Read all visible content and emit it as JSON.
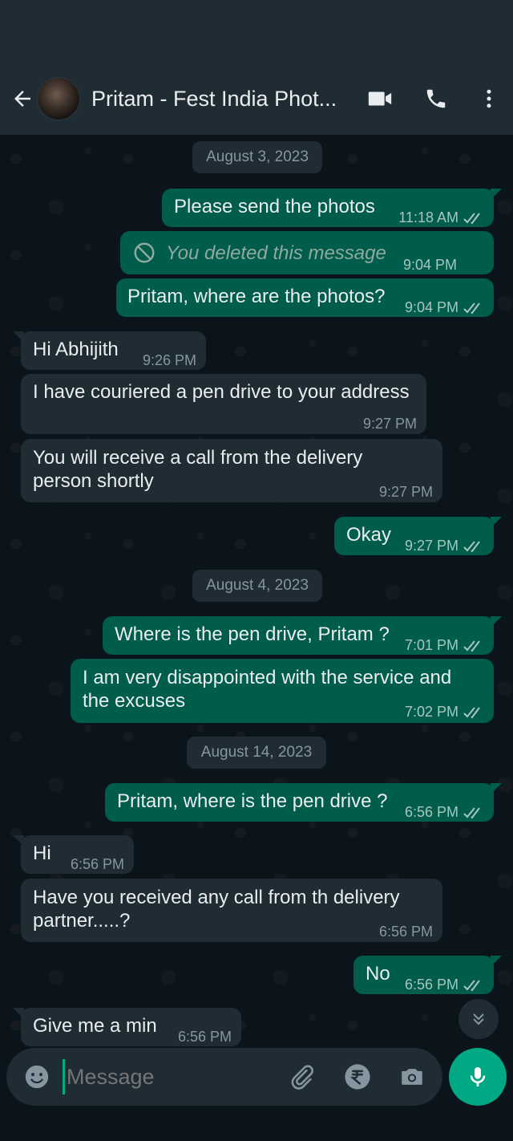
{
  "header": {
    "title": "Pritam - Fest India Phot...",
    "icons": [
      "back-arrow-icon",
      "video-call-icon",
      "voice-call-icon",
      "more-options-icon"
    ]
  },
  "date_chips": [
    "August 3, 2023",
    "August 4, 2023",
    "August 14, 2023"
  ],
  "messages": [
    {
      "dir": "out",
      "text": "Please send the photos",
      "time": "11:18 AM",
      "status": "read"
    },
    {
      "dir": "out",
      "deleted": true,
      "text": "You deleted this message",
      "time": "9:04 PM"
    },
    {
      "dir": "out",
      "text": "Pritam, where are the photos?",
      "time": "9:04 PM",
      "status": "read"
    },
    {
      "dir": "in",
      "text": "Hi Abhijith",
      "time": "9:26 PM"
    },
    {
      "dir": "in",
      "text": "I have couriered a pen drive to your address",
      "time": "9:27 PM"
    },
    {
      "dir": "in",
      "text_line1": "You will receive a call from the delivery",
      "text_line2": "person shortly",
      "time": "9:27 PM"
    },
    {
      "dir": "out",
      "text": "Okay",
      "time": "9:27 PM",
      "status": "read"
    },
    {
      "dir": "out",
      "text": "Where is the pen drive, Pritam ?",
      "time": "7:01 PM",
      "status": "read"
    },
    {
      "dir": "out",
      "text_line1": "I am very disappointed with the service and",
      "text_line2": "the excuses",
      "time": "7:02 PM",
      "status": "read"
    },
    {
      "dir": "out",
      "text": "Pritam, where is the pen drive ?",
      "time": "6:56 PM",
      "status": "read"
    },
    {
      "dir": "in",
      "text": "Hi",
      "time": "6:56 PM"
    },
    {
      "dir": "in",
      "text_line1": "Have you received any call from th delivery",
      "text_line2": "partner.....?",
      "time": "6:56 PM"
    },
    {
      "dir": "out",
      "text": "No",
      "time": "6:56 PM",
      "status": "read"
    },
    {
      "dir": "in",
      "text": "Give me a min",
      "time": "6:56 PM"
    }
  ],
  "composer": {
    "placeholder": "Message",
    "icons": [
      "emoji-icon",
      "attach-icon",
      "rupee-payment-icon",
      "camera-icon",
      "mic-icon"
    ]
  },
  "colors": {
    "outgoing_bubble": "#005c4b",
    "incoming_bubble": "#1f2c34",
    "accent": "#00a884",
    "read_ticks": "#a9c5bd"
  }
}
